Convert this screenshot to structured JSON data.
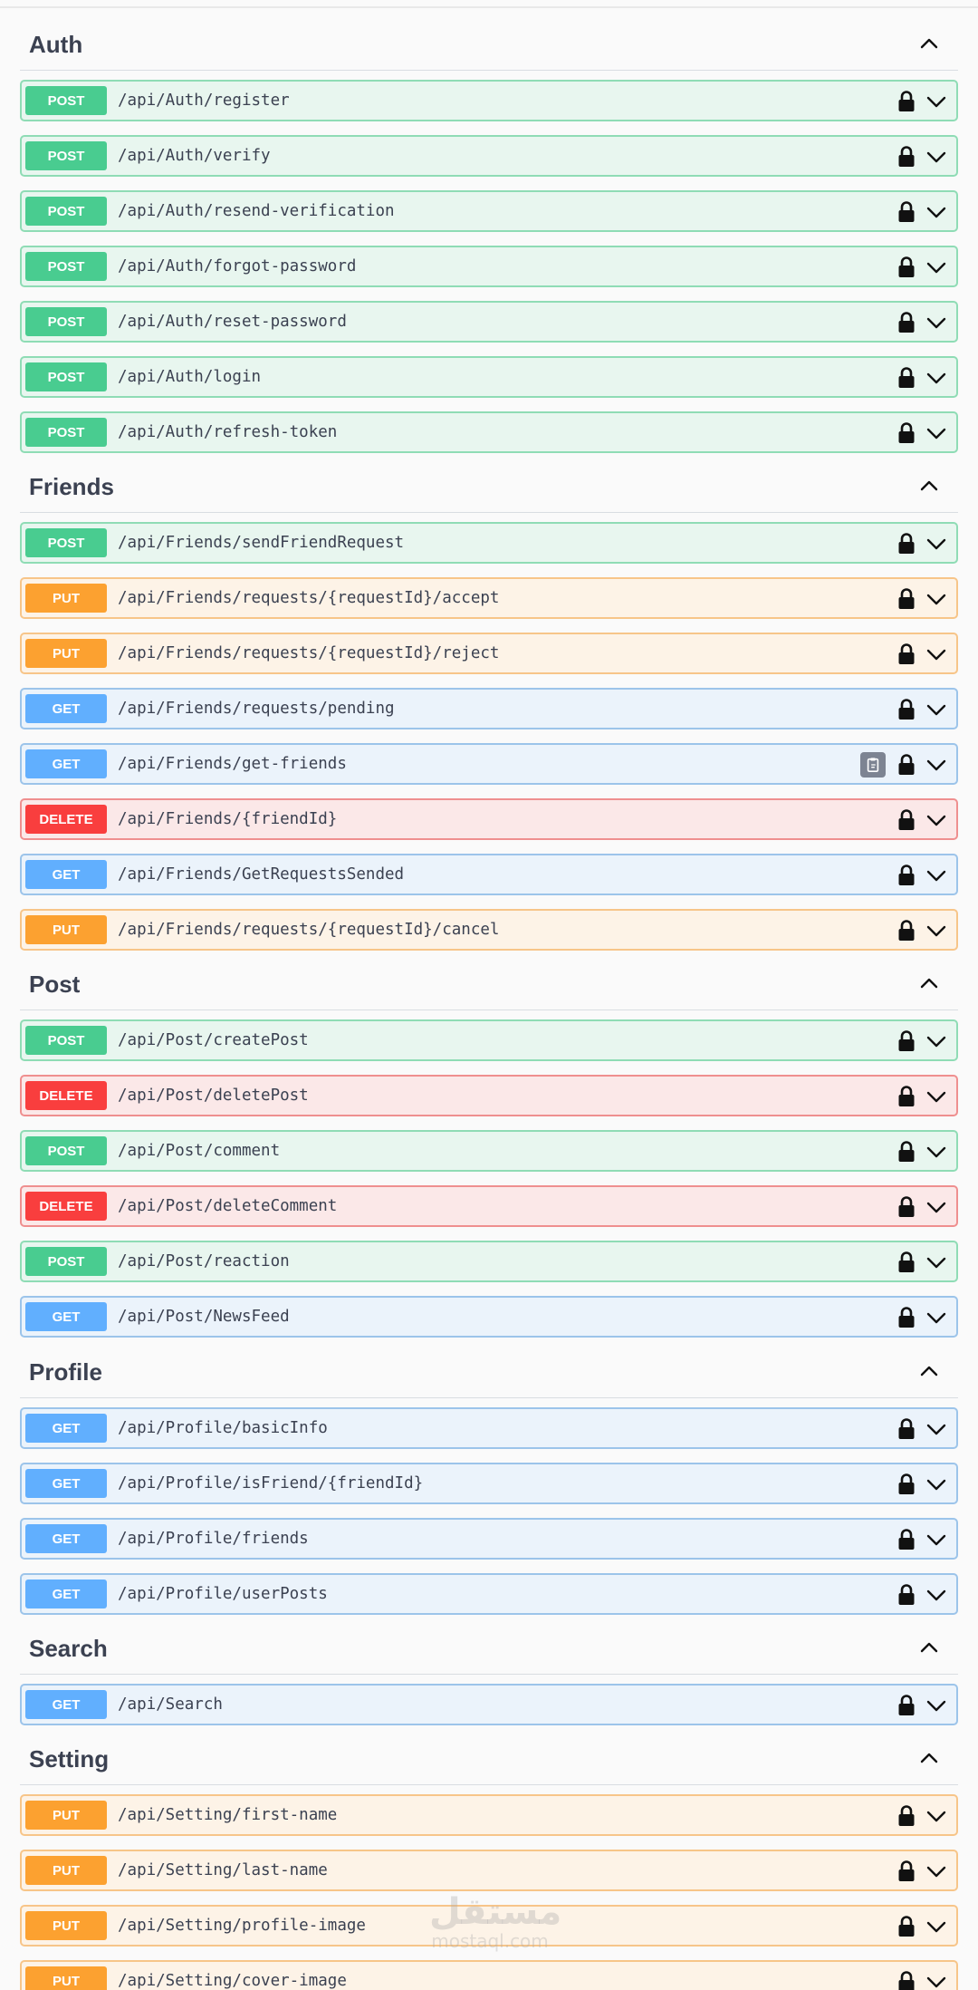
{
  "sections": [
    {
      "title": "Auth",
      "operations": [
        {
          "method": "POST",
          "path": "/api/Auth/register"
        },
        {
          "method": "POST",
          "path": "/api/Auth/verify"
        },
        {
          "method": "POST",
          "path": "/api/Auth/resend-verification"
        },
        {
          "method": "POST",
          "path": "/api/Auth/forgot-password"
        },
        {
          "method": "POST",
          "path": "/api/Auth/reset-password"
        },
        {
          "method": "POST",
          "path": "/api/Auth/login"
        },
        {
          "method": "POST",
          "path": "/api/Auth/refresh-token"
        }
      ]
    },
    {
      "title": "Friends",
      "operations": [
        {
          "method": "POST",
          "path": "/api/Friends/sendFriendRequest"
        },
        {
          "method": "PUT",
          "path": "/api/Friends/requests/{requestId}/accept"
        },
        {
          "method": "PUT",
          "path": "/api/Friends/requests/{requestId}/reject"
        },
        {
          "method": "GET",
          "path": "/api/Friends/requests/pending"
        },
        {
          "method": "GET",
          "path": "/api/Friends/get-friends",
          "copy_icon": "clipboard-icon"
        },
        {
          "method": "DELETE",
          "path": "/api/Friends/{friendId}"
        },
        {
          "method": "GET",
          "path": "/api/Friends/GetRequestsSended"
        },
        {
          "method": "PUT",
          "path": "/api/Friends/requests/{requestId}/cancel"
        }
      ]
    },
    {
      "title": "Post",
      "operations": [
        {
          "method": "POST",
          "path": "/api/Post/createPost"
        },
        {
          "method": "DELETE",
          "path": "/api/Post/deletePost"
        },
        {
          "method": "POST",
          "path": "/api/Post/comment"
        },
        {
          "method": "DELETE",
          "path": "/api/Post/deleteComment"
        },
        {
          "method": "POST",
          "path": "/api/Post/reaction"
        },
        {
          "method": "GET",
          "path": "/api/Post/NewsFeed"
        }
      ]
    },
    {
      "title": "Profile",
      "operations": [
        {
          "method": "GET",
          "path": "/api/Profile/basicInfo"
        },
        {
          "method": "GET",
          "path": "/api/Profile/isFriend/{friendId}"
        },
        {
          "method": "GET",
          "path": "/api/Profile/friends"
        },
        {
          "method": "GET",
          "path": "/api/Profile/userPosts"
        }
      ]
    },
    {
      "title": "Search",
      "operations": [
        {
          "method": "GET",
          "path": "/api/Search"
        }
      ]
    },
    {
      "title": "Setting",
      "operations": [
        {
          "method": "PUT",
          "path": "/api/Setting/first-name"
        },
        {
          "method": "PUT",
          "path": "/api/Setting/last-name"
        },
        {
          "method": "PUT",
          "path": "/api/Setting/profile-image"
        },
        {
          "method": "PUT",
          "path": "/api/Setting/cover-image"
        }
      ]
    }
  ],
  "icons": {
    "lock": "lock-icon",
    "expand": "chevron-down-icon",
    "collapse": "chevron-up-icon"
  },
  "colors": {
    "post": "#49cc90",
    "put": "#fca130",
    "get": "#61affe",
    "delete": "#f93e3e",
    "text": "#3b4151"
  },
  "watermark": {
    "arabic": "مستقل",
    "latin": "mostaql.com"
  }
}
